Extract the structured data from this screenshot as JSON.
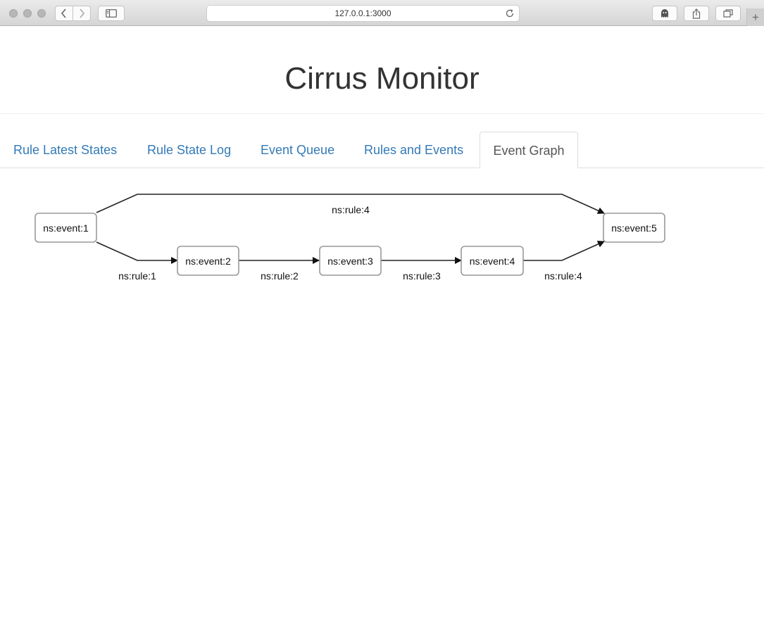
{
  "browser": {
    "url": "127.0.0.1:3000",
    "icons": [
      "back-icon",
      "forward-icon",
      "sidebar-icon",
      "reload-icon",
      "ghostery-icon",
      "share-icon",
      "tabs-icon",
      "plus-icon"
    ],
    "new_tab_glyph": "+"
  },
  "header": {
    "title": "Cirrus Monitor"
  },
  "tabs": [
    {
      "label": "Rule Latest States",
      "active": false
    },
    {
      "label": "Rule State Log",
      "active": false
    },
    {
      "label": "Event Queue",
      "active": false
    },
    {
      "label": "Rules and Events",
      "active": false
    },
    {
      "label": "Event Graph",
      "active": true
    }
  ],
  "graph": {
    "nodes": [
      "ns:event:1",
      "ns:event:2",
      "ns:event:3",
      "ns:event:4",
      "ns:event:5"
    ],
    "edges": [
      {
        "from": "ns:event:1",
        "to": "ns:event:5",
        "label": "ns:rule:4"
      },
      {
        "from": "ns:event:1",
        "to": "ns:event:2",
        "label": "ns:rule:1"
      },
      {
        "from": "ns:event:2",
        "to": "ns:event:3",
        "label": "ns:rule:2"
      },
      {
        "from": "ns:event:3",
        "to": "ns:event:4",
        "label": "ns:rule:3"
      },
      {
        "from": "ns:event:4",
        "to": "ns:event:5",
        "label": "ns:rule:4"
      }
    ]
  }
}
